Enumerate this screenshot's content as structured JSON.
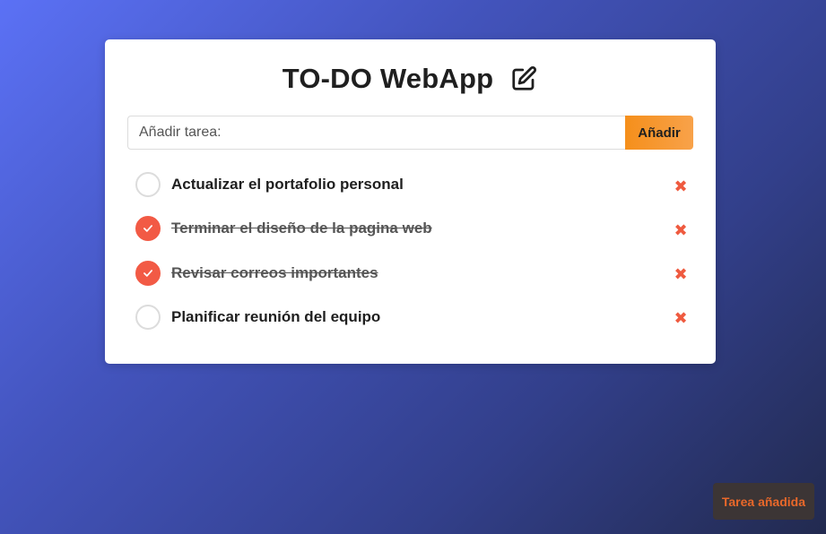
{
  "app": {
    "title": "TO-DO WebApp",
    "title_icon": "edit-icon"
  },
  "form": {
    "placeholder": "Añadir tarea:",
    "value": "",
    "add_label": "Añadir"
  },
  "tasks": [
    {
      "text": "Actualizar el portafolio personal",
      "done": false
    },
    {
      "text": "Terminar el diseño de la pagina web",
      "done": true
    },
    {
      "text": "Revisar correos importantes",
      "done": true
    },
    {
      "text": "Planificar reunión del equipo",
      "done": false
    }
  ],
  "delete_symbol": "✖",
  "toast": {
    "message": "Tarea añadida"
  },
  "colors": {
    "accent_orange": "#f58f1b",
    "check_red": "#f25a45",
    "delete_red": "#ef5a3f",
    "toast_bg": "#3c3535",
    "toast_text": "#e9682a"
  }
}
